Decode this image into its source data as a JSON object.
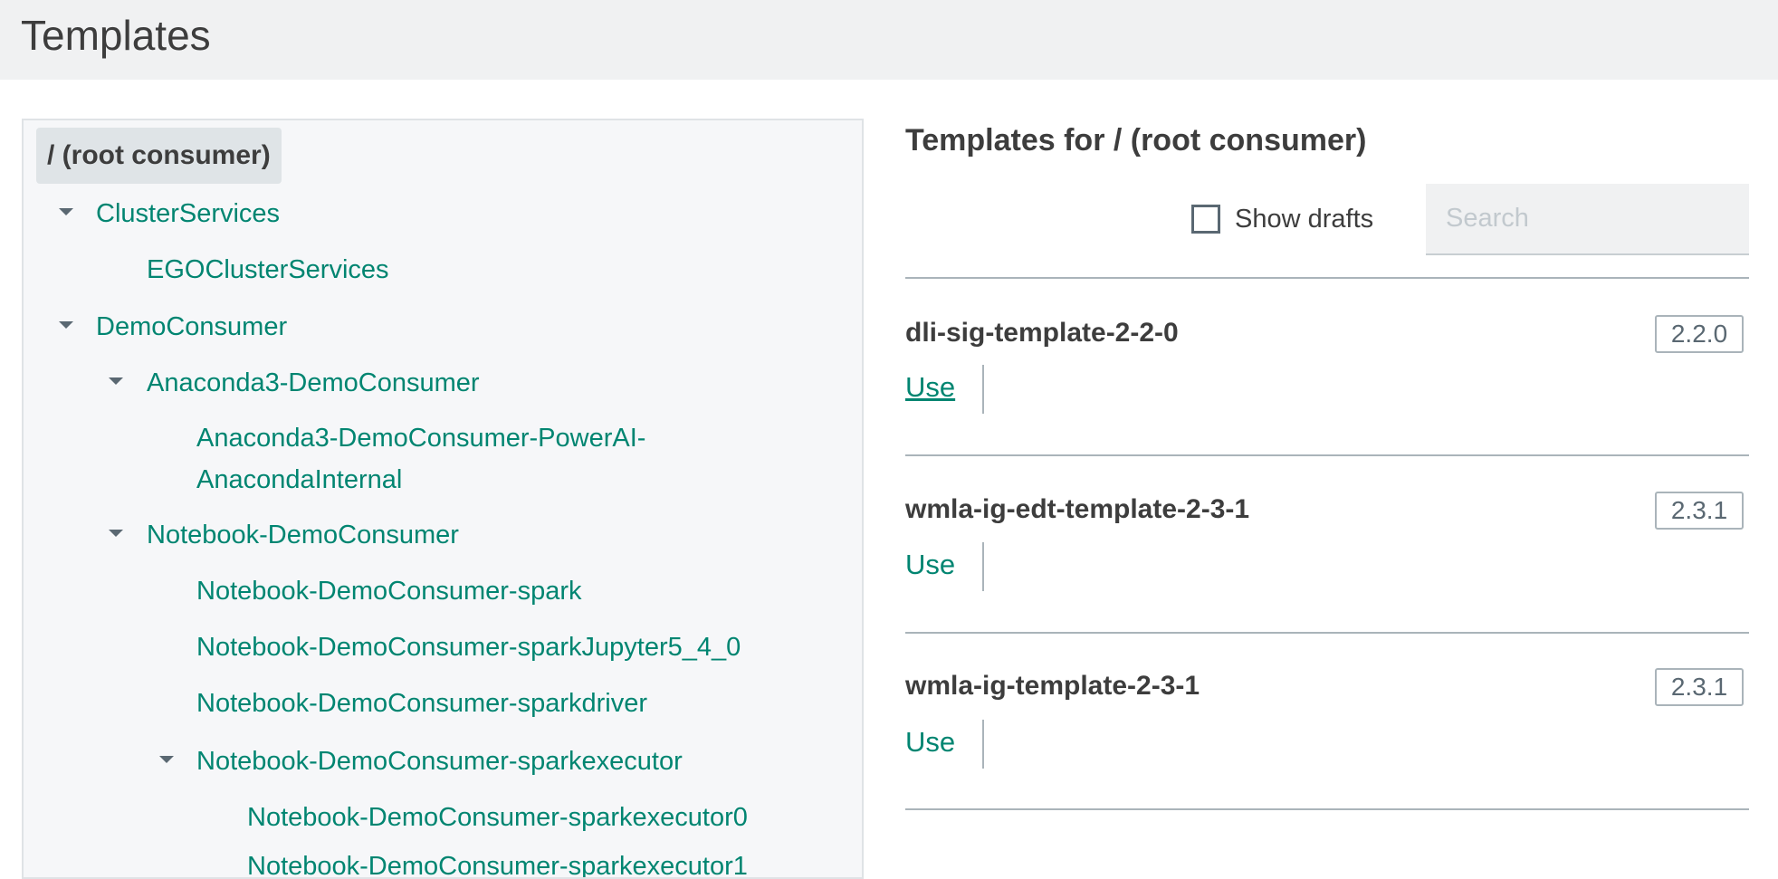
{
  "header": {
    "title": "Templates"
  },
  "tree": {
    "root_label": "/ (root consumer)",
    "nodes": [
      {
        "label": "ClusterServices"
      },
      {
        "label": "EGOClusterServices"
      },
      {
        "label": "DemoConsumer"
      },
      {
        "label": "Anaconda3-DemoConsumer"
      },
      {
        "label_line1": "Anaconda3-DemoConsumer-PowerAI-",
        "label_line2": "AnacondaInternal"
      },
      {
        "label": "Notebook-DemoConsumer"
      },
      {
        "label": "Notebook-DemoConsumer-spark"
      },
      {
        "label": "Notebook-DemoConsumer-sparkJupyter5_4_0"
      },
      {
        "label": "Notebook-DemoConsumer-sparkdriver"
      },
      {
        "label": "Notebook-DemoConsumer-sparkexecutor"
      },
      {
        "label": "Notebook-DemoConsumer-sparkexecutor0"
      },
      {
        "label": "Notebook-DemoConsumer-sparkexecutor1"
      }
    ]
  },
  "main": {
    "title": "Templates for / (root consumer)",
    "show_drafts_label": "Show drafts",
    "show_drafts_checked": false,
    "search_placeholder": "Search",
    "templates": [
      {
        "name": "dli-sig-template-2-2-0",
        "version": "2.2.0",
        "action": "Use"
      },
      {
        "name": "wmla-ig-edt-template-2-3-1",
        "version": "2.3.1",
        "action": "Use"
      },
      {
        "name": "wmla-ig-template-2-3-1",
        "version": "2.3.1",
        "action": "Use"
      }
    ]
  },
  "colors": {
    "link": "#008571",
    "header_bg": "#f0f1f2",
    "panel_bg": "#f6f7f9",
    "selected_bg": "#dfe4e7"
  }
}
